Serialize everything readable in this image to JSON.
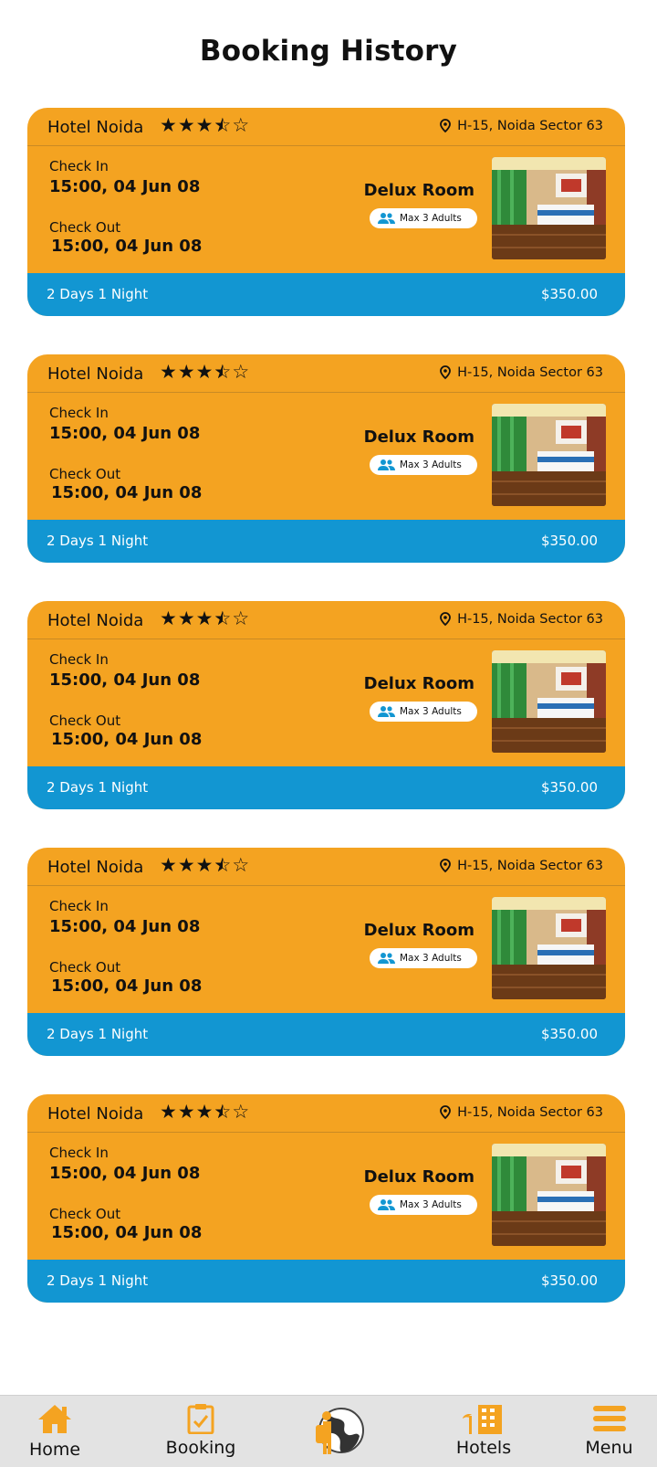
{
  "page": {
    "title": "Booking History"
  },
  "colors": {
    "card": "#f4a321",
    "footer": "#1296d2",
    "icon_orange": "#f4a321",
    "icon_blue": "#1296d2"
  },
  "bookings": [
    {
      "hotel": "Hotel Noida",
      "rating": 3.5,
      "rating_text": "★★★",
      "location": "H-15, Noida Sector 63",
      "checkin_label": "Check In",
      "checkin": "15:00, 04 Jun 08",
      "checkout_label": "Check Out",
      "checkout": "15:00, 04 Jun 08",
      "room": "Delux Room",
      "occupancy": "Max 3 Adults",
      "duration": "2 Days 1 Night",
      "price": "$350.00"
    },
    {
      "hotel": "Hotel Noida",
      "rating": 3.5,
      "rating_text": "★★★",
      "location": "H-15, Noida Sector 63",
      "checkin_label": "Check In",
      "checkin": "15:00, 04 Jun 08",
      "checkout_label": "Check Out",
      "checkout": "15:00, 04 Jun 08",
      "room": "Delux Room",
      "occupancy": "Max 3 Adults",
      "duration": "2 Days 1 Night",
      "price": "$350.00"
    },
    {
      "hotel": "Hotel Noida",
      "rating": 3.5,
      "rating_text": "★★★",
      "location": "H-15, Noida Sector 63",
      "checkin_label": "Check In",
      "checkin": "15:00, 04 Jun 08",
      "checkout_label": "Check Out",
      "checkout": "15:00, 04 Jun 08",
      "room": "Delux Room",
      "occupancy": "Max 3 Adults",
      "duration": "2 Days 1 Night",
      "price": "$350.00"
    },
    {
      "hotel": "Hotel Noida",
      "rating": 3.5,
      "rating_text": "★★★",
      "location": "H-15, Noida Sector 63",
      "checkin_label": "Check In",
      "checkin": "15:00, 04 Jun 08",
      "checkout_label": "Check Out",
      "checkout": "15:00, 04 Jun 08",
      "room": "Delux Room",
      "occupancy": "Max 3 Adults",
      "duration": "2 Days 1 Night",
      "price": "$350.00"
    },
    {
      "hotel": "Hotel Noida",
      "rating": 3.5,
      "rating_text": "★★★",
      "location": "H-15, Noida Sector 63",
      "checkin_label": "Check In",
      "checkin": "15:00, 04 Jun 08",
      "checkout_label": "Check Out",
      "checkout": "15:00, 04 Jun 08",
      "room": "Delux Room",
      "occupancy": "Max 3 Adults",
      "duration": "2 Days 1 Night",
      "price": "$350.00"
    }
  ],
  "nav": {
    "items": [
      {
        "label": "Home",
        "icon": "home-icon"
      },
      {
        "label": "Booking",
        "icon": "clipboard-check-icon"
      },
      {
        "label": "",
        "icon": "traveler-globe-icon"
      },
      {
        "label": "Hotels",
        "icon": "hotel-building-icon"
      },
      {
        "label": "Menu",
        "icon": "hamburger-menu-icon"
      }
    ]
  }
}
